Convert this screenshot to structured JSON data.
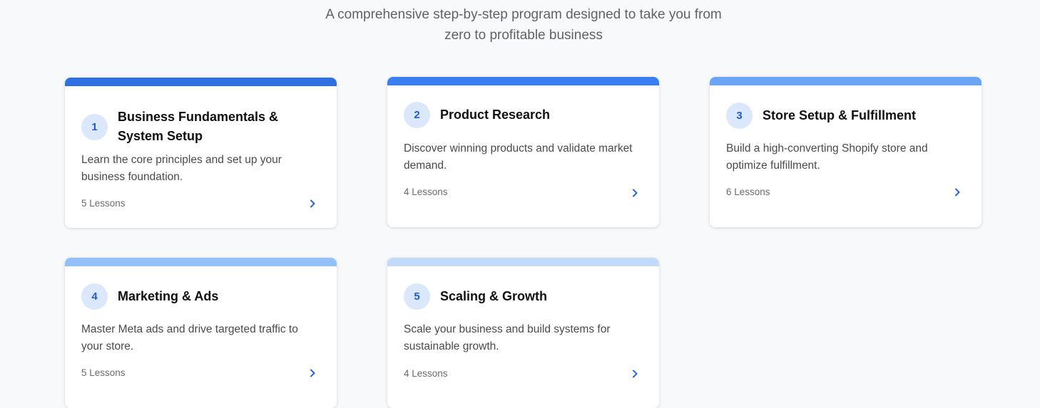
{
  "intro": {
    "line1": "A comprehensive step-by-step program designed to take you from",
    "line2": "zero to profitable business"
  },
  "modules": [
    {
      "number": "1",
      "title": "Business Fundamentals & System Setup",
      "description": "Learn the core principles and set up your business foundation.",
      "lessons": "5 Lessons",
      "bar_color": "#2f6fe4",
      "icon": "chevron-right-icon"
    },
    {
      "number": "2",
      "title": "Product Research",
      "description": "Discover winning products and validate market demand.",
      "lessons": "4 Lessons",
      "bar_color": "#3a7ff0",
      "icon": "chevron-right-icon"
    },
    {
      "number": "3",
      "title": "Store Setup & Fulfillment",
      "description": "Build a high-converting Shopify store and optimize fulfillment.",
      "lessons": "6 Lessons",
      "bar_color": "#6aa5f5",
      "icon": "chevron-right-icon"
    },
    {
      "number": "4",
      "title": "Marketing & Ads",
      "description": "Master Meta ads and drive targeted traffic to your store.",
      "lessons": "5 Lessons",
      "bar_color": "#93c0f7",
      "icon": "chevron-right-icon"
    },
    {
      "number": "5",
      "title": "Scaling & Growth",
      "description": "Scale your business and build systems for sustainable growth.",
      "lessons": "4 Lessons",
      "bar_color": "#c2dbfa",
      "icon": "chevron-right-icon"
    }
  ]
}
